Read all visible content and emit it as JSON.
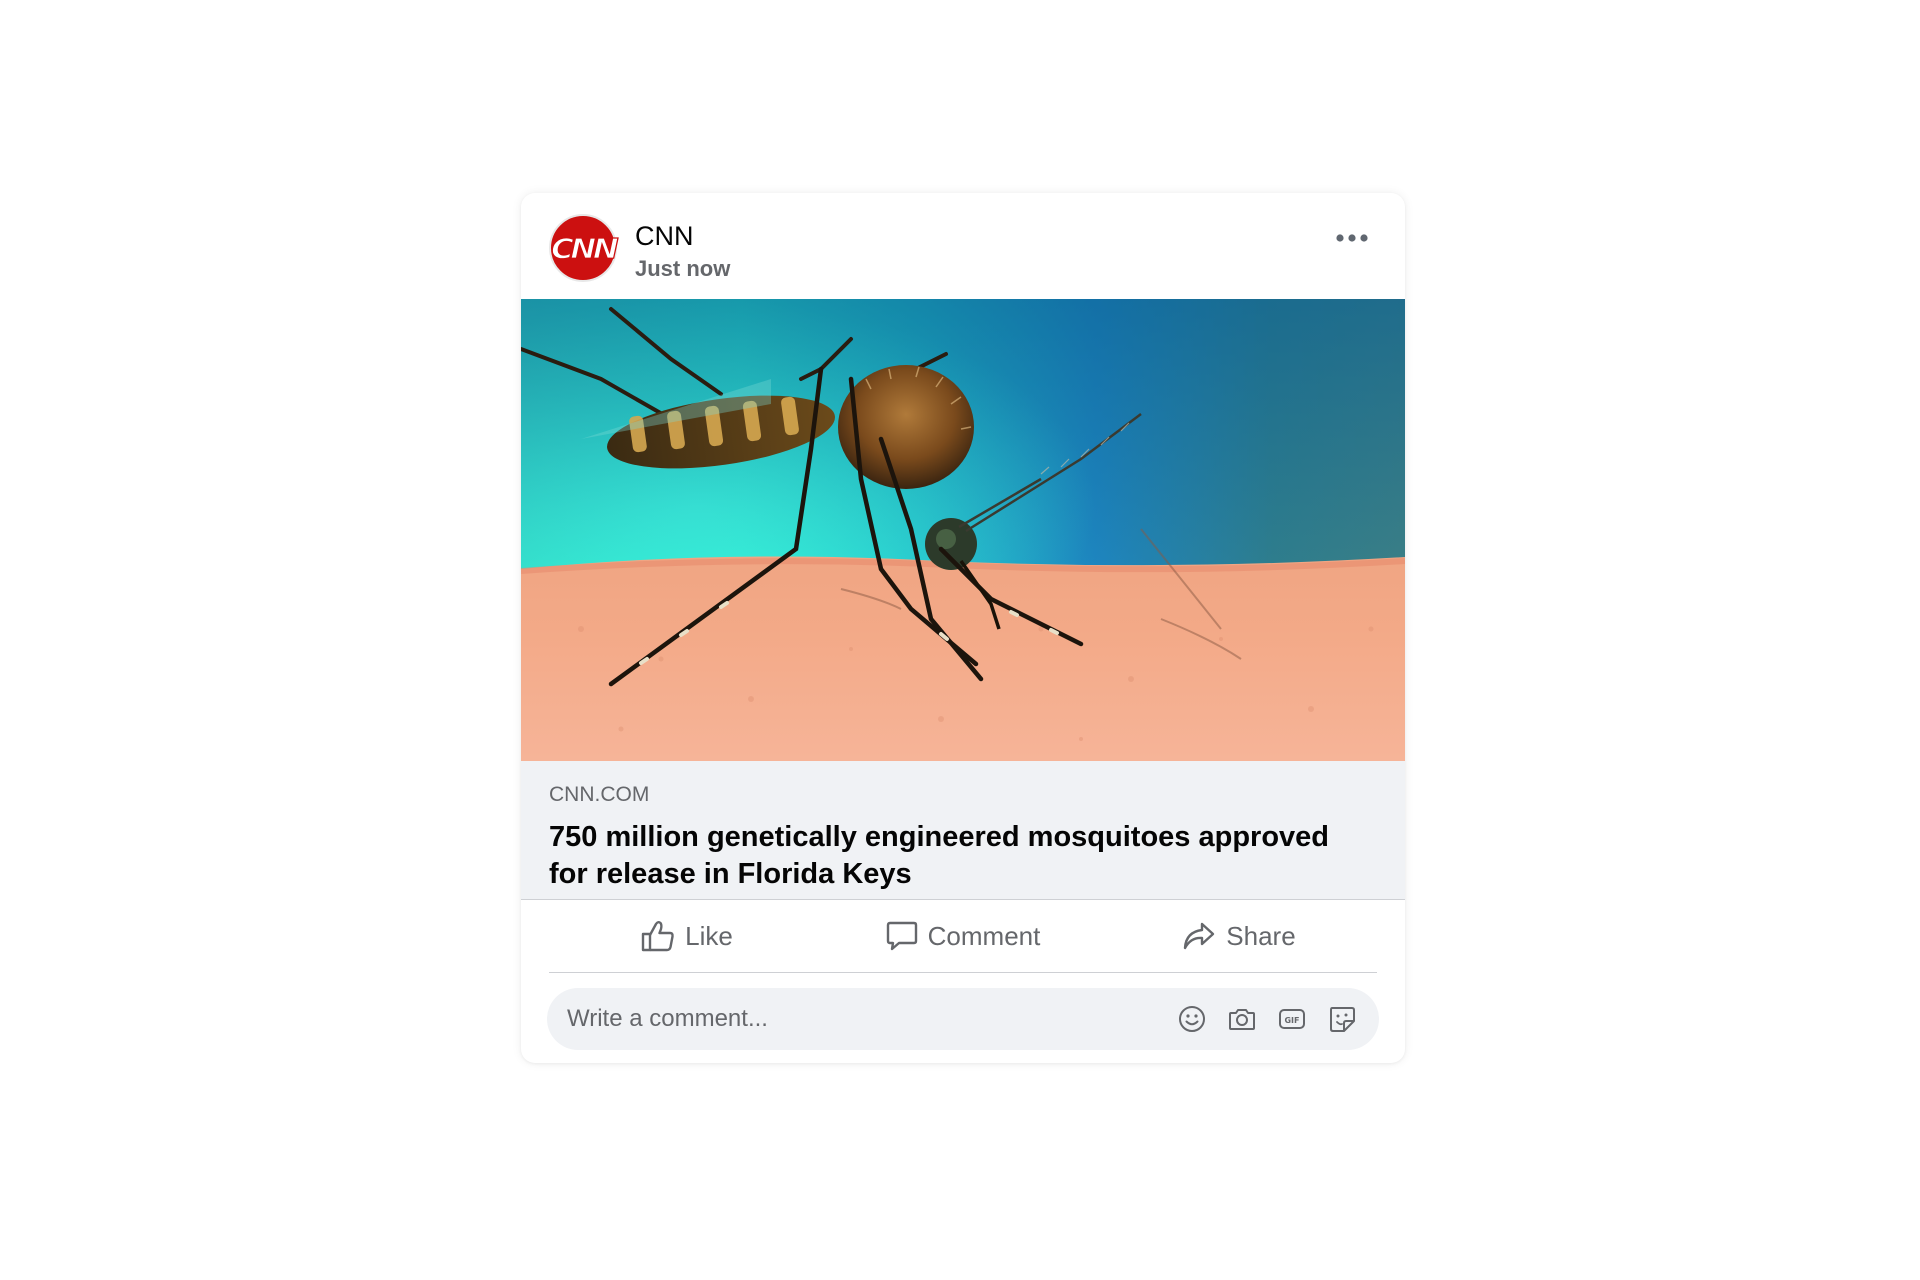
{
  "post": {
    "author": "CNN",
    "avatar_text": "CNN",
    "timestamp": "Just now",
    "more_icon": "more-horizontal-icon"
  },
  "link": {
    "image_alt": "Close-up of a mosquito biting skin",
    "domain": "CNN.COM",
    "headline": "750 million genetically engineered mosquitoes approved for release in Florida Keys"
  },
  "actions": {
    "like_label": "Like",
    "comment_label": "Comment",
    "share_label": "Share"
  },
  "comment_box": {
    "placeholder": "Write a comment...",
    "icons": [
      "emoji-icon",
      "camera-icon",
      "gif-icon",
      "sticker-icon"
    ]
  },
  "colors": {
    "brand_red": "#cc1010",
    "text_primary": "#050505",
    "text_secondary": "#65676b",
    "preview_bg": "#f0f2f5"
  }
}
